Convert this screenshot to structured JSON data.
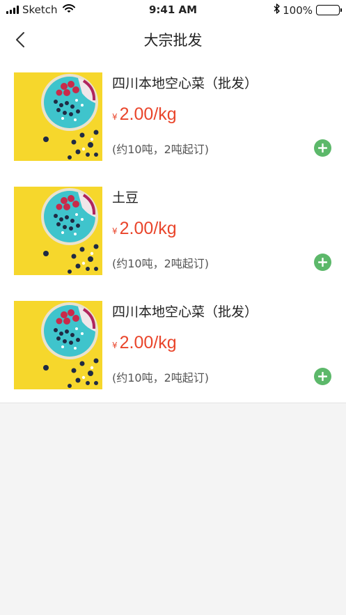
{
  "status_bar": {
    "carrier": "Sketch",
    "time": "9:41 AM",
    "battery": "100%",
    "icons": [
      "signal-icon",
      "wifi-icon",
      "bluetooth-icon",
      "battery-icon"
    ]
  },
  "nav": {
    "title": "大宗批发",
    "back_icon": "chevron-left-icon"
  },
  "products": [
    {
      "name": "四川本地空心菜（批发）",
      "currency": "¥",
      "price": "2.00",
      "unit": "/kg",
      "note": "(约10吨，2吨起订)",
      "add_icon": "plus-circle-icon"
    },
    {
      "name": "土豆",
      "currency": "¥",
      "price": "2.00",
      "unit": "/kg",
      "note": "(约10吨，2吨起订)",
      "add_icon": "plus-circle-icon"
    },
    {
      "name": "四川本地空心菜（批发）",
      "currency": "¥",
      "price": "2.00",
      "unit": "/kg",
      "note": "(约10吨，2吨起订)",
      "add_icon": "plus-circle-icon"
    }
  ],
  "colors": {
    "price": "#e9452b",
    "add_button": "#5cb86a",
    "thumb_background": "#f6d72c",
    "bowl": "#3fc4cc",
    "page_background": "#f4f4f4"
  }
}
